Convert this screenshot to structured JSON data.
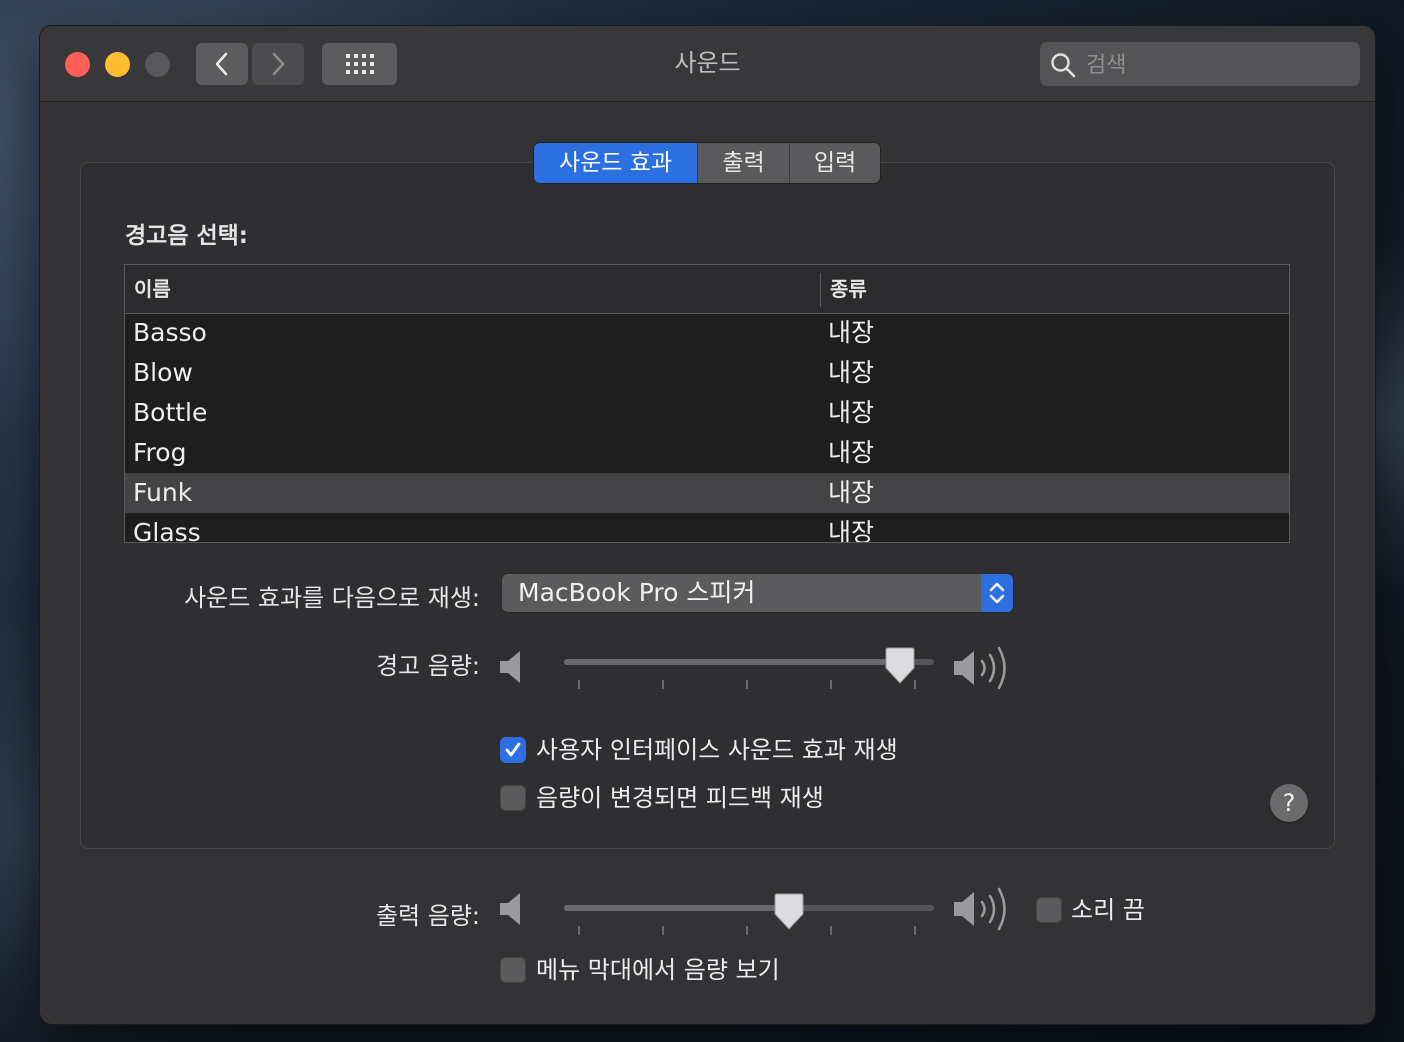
{
  "window": {
    "title": "사운드"
  },
  "search": {
    "placeholder": "검색",
    "value": ""
  },
  "tabs": [
    {
      "label": "사운드 효과",
      "active": true
    },
    {
      "label": "출력",
      "active": false
    },
    {
      "label": "입력",
      "active": false
    }
  ],
  "alert": {
    "section_label": "경고음 선택:",
    "columns": {
      "name": "이름",
      "type": "종류"
    },
    "rows": [
      {
        "name": "Basso",
        "type": "내장",
        "selected": false
      },
      {
        "name": "Blow",
        "type": "내장",
        "selected": false
      },
      {
        "name": "Bottle",
        "type": "내장",
        "selected": false
      },
      {
        "name": "Frog",
        "type": "내장",
        "selected": false
      },
      {
        "name": "Funk",
        "type": "내장",
        "selected": true
      },
      {
        "name": "Glass",
        "type": "내장",
        "selected": false
      }
    ]
  },
  "playback": {
    "label": "사운드 효과를 다음으로 재생:",
    "selected": "MacBook Pro 스피커"
  },
  "alert_volume": {
    "label": "경고 음량:",
    "value_fraction": 0.95
  },
  "options": {
    "ui_sounds": {
      "label": "사용자 인터페이스 사운드 효과 재생",
      "checked": true
    },
    "feedback": {
      "label": "음량이 변경되면 피드백 재생",
      "checked": false
    }
  },
  "help": {
    "label": "?"
  },
  "output_volume": {
    "label": "출력 음량:",
    "value_fraction": 0.62
  },
  "mute": {
    "label": "소리 끔",
    "checked": false
  },
  "menubar_volume": {
    "label": "메뉴 막대에서 음량 보기",
    "checked": false
  },
  "colors": {
    "accent": "#2c6fe0",
    "close": "#fe5f57",
    "minimize": "#febc2e"
  },
  "icons": [
    "chevron-left-icon",
    "chevron-right-icon",
    "grid-icon",
    "search-icon",
    "speaker-low-icon",
    "speaker-high-icon",
    "checkmark-icon",
    "up-down-chevron-icon"
  ]
}
